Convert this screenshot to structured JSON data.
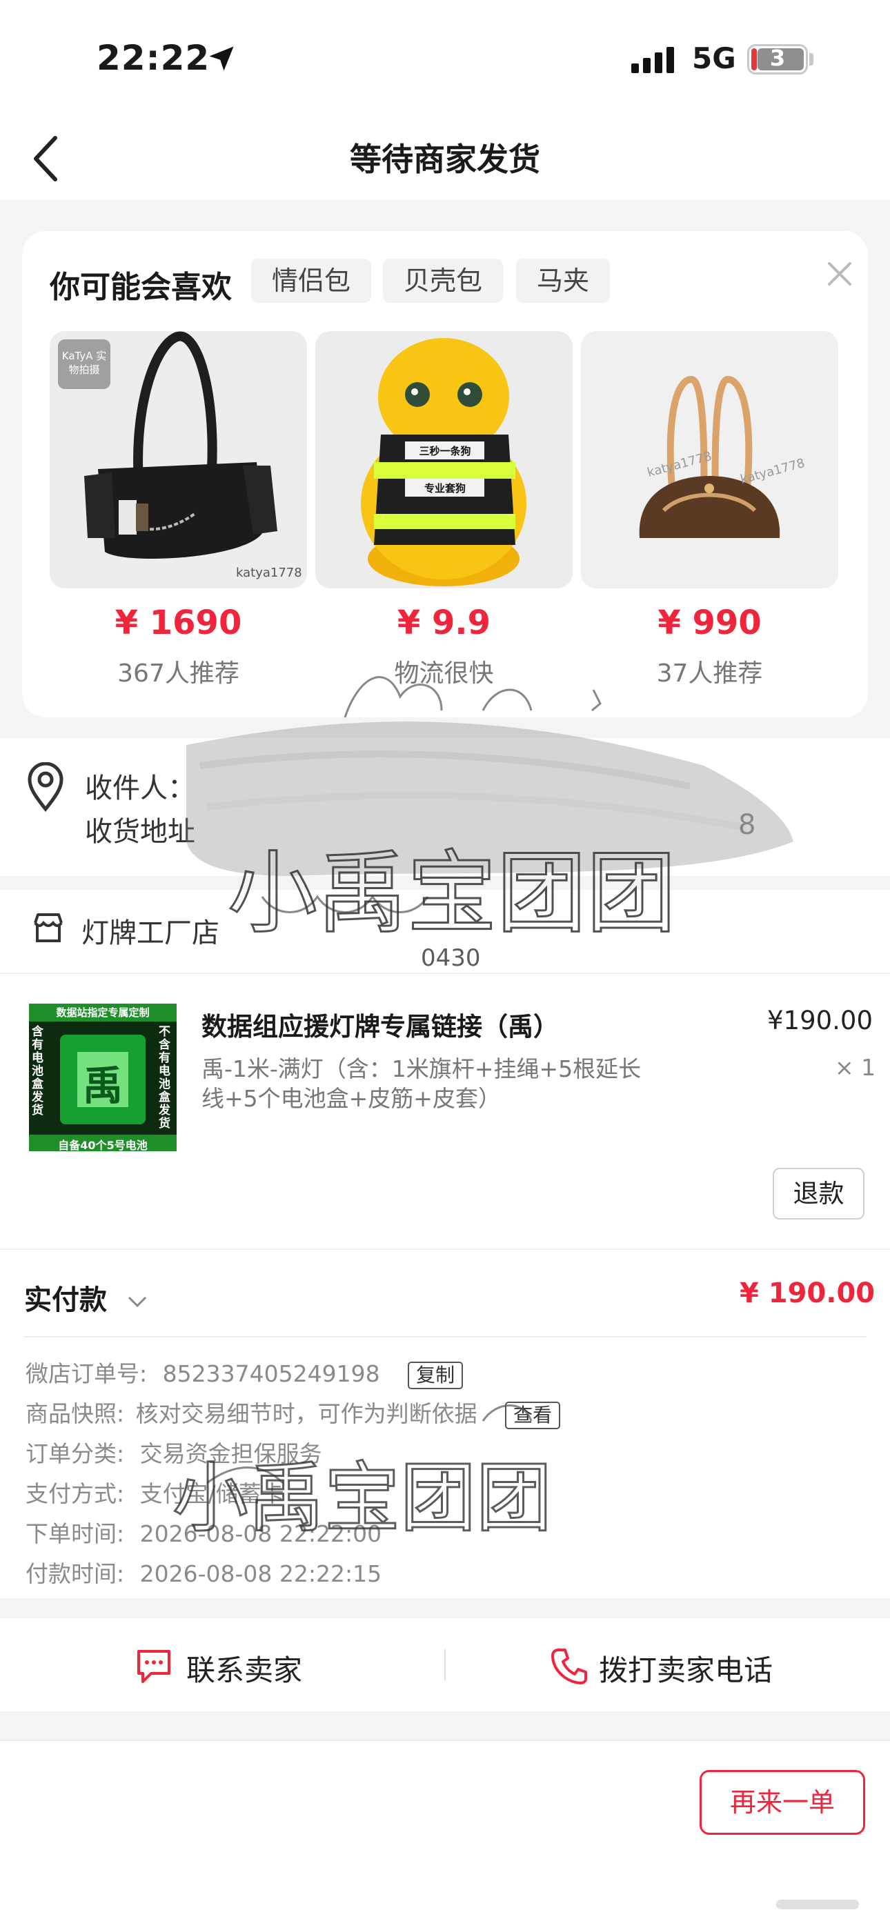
{
  "status_bar": {
    "time": "22:22",
    "network": "5G",
    "battery": "3"
  },
  "nav": {
    "title": "等待商家发货"
  },
  "recommend": {
    "title": "你可能会喜欢",
    "chips": [
      "情侣包",
      "贝壳包",
      "马夹"
    ],
    "products": [
      {
        "price": "¥ 1690",
        "subtitle": "367人推荐",
        "badge": "KaTyA 实物拍摄",
        "watermark": "katya1778"
      },
      {
        "price": "¥ 9.9",
        "subtitle": "物流很快",
        "vest_text_1": "三秒一条狗",
        "vest_text_2": "专业套狗"
      },
      {
        "price": "¥ 990",
        "subtitle": "37人推荐",
        "watermark": "katya1778"
      }
    ]
  },
  "address": {
    "recipient_label": "收件人：",
    "address_label": "收货地址",
    "trailing": "8"
  },
  "shop": {
    "name": "灯牌工厂店",
    "item": {
      "title": "数据组应援灯牌专属链接（禹）",
      "price": "¥190.00",
      "spec": "禹-1米-满灯（含：1米旗杆+挂绳+5根延长线+5个电池盒+皮筋+皮套）",
      "qty": "× 1",
      "thumb_lines": [
        "数据站指定专属定制",
        "含有电池盒发货",
        "不含有电池盒发货",
        "自备40个5号电池",
        "禹"
      ]
    },
    "refund_label": "退款"
  },
  "payment": {
    "label": "实付款",
    "amount": "¥ 190.00",
    "rows": [
      {
        "label": "微店订单号:",
        "value": "852337405249198",
        "tag": "复制"
      },
      {
        "label": "商品快照:",
        "value": "核对交易细节时，可作为判断依据",
        "tag": "查看"
      },
      {
        "label": "订单分类:",
        "value": "交易资金担保服务"
      },
      {
        "label": "支付方式:",
        "value": "支付宝/储蓄卡"
      },
      {
        "label": "下单时间:",
        "value": "2026-08-08 22:22:00"
      },
      {
        "label": "付款时间:",
        "value": "2026-08-08 22:22:15"
      }
    ]
  },
  "contact": {
    "seller_label": "联系卖家",
    "call_label": "拨打卖家电话"
  },
  "bottom": {
    "reorder_label": "再来一单"
  },
  "stamp": {
    "text": "小禹宝团团",
    "date": "0430"
  },
  "colors": {
    "accent": "#f0243a",
    "page_bg": "#f4f4f4"
  }
}
